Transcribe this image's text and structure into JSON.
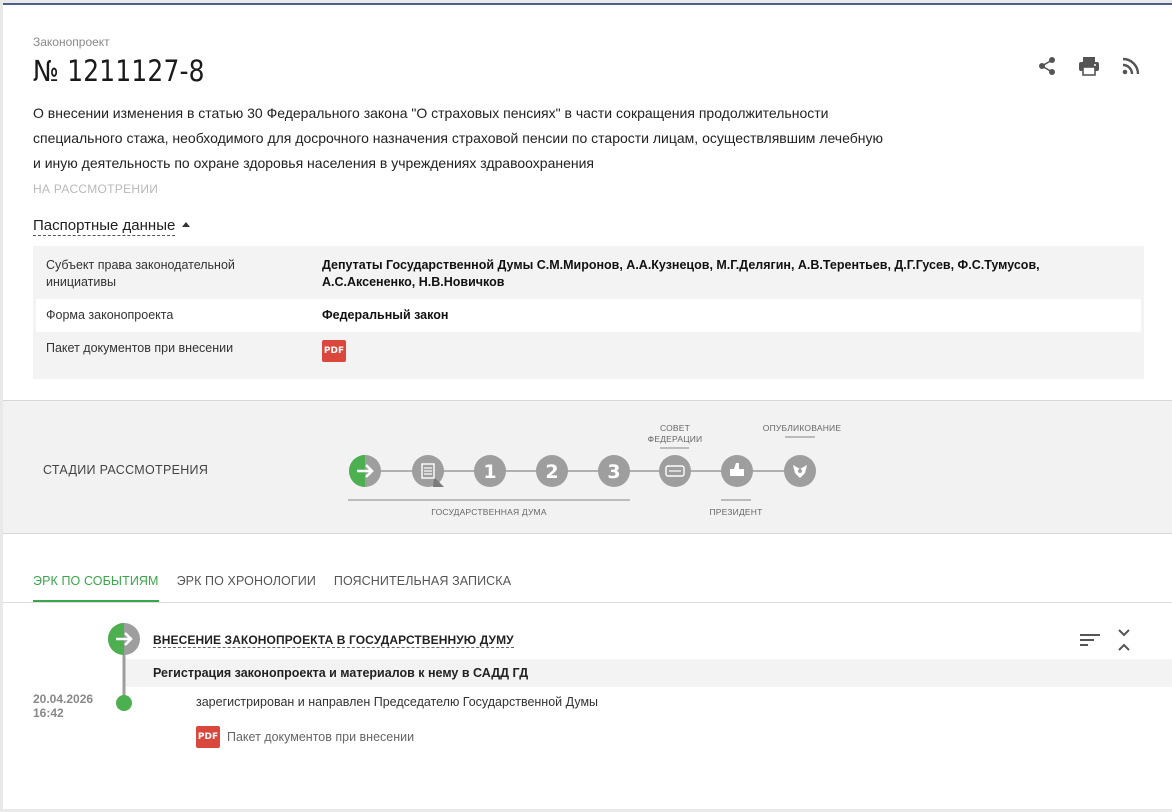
{
  "header": {
    "kicker": "Законопроект",
    "number": "№ 1211127-8",
    "description": "О внесении изменения в статью 30 Федерального закона \"О страховых пенсиях\" в части сокращения продолжительности специального стажа, необходимого для досрочного назначения страховой пенсии по старости лицам, осуществлявшим лечебную и иную деятельность по охране здоровья населения в учреждениях здравоохранения",
    "status": "НА РАССМОТРЕНИИ",
    "passport_toggle": "Паспортные данные"
  },
  "toolbar": {
    "icons": [
      "share-icon",
      "print-icon",
      "rss-icon"
    ]
  },
  "passport": {
    "rows": [
      {
        "key": "Субъект права законодательной инициативы",
        "value": "Депутаты Государственной Думы С.М.Миронов, А.А.Кузнецов, М.Г.Делягин, А.В.Терентьев, Д.Г.Гусев, Ф.С.Тумусов, А.С.Аксененко, Н.В.Новичков"
      },
      {
        "key": "Форма законопроекта",
        "value": "Федеральный закон"
      },
      {
        "key": "Пакет документов при внесении",
        "value": "PDF"
      }
    ]
  },
  "stages": {
    "title": "СТАДИИ РАССМОТРЕНИЯ",
    "items": [
      {
        "icon": "arrow-right-icon",
        "label": "",
        "active": true
      },
      {
        "icon": "document-icon",
        "label": "",
        "active": false
      },
      {
        "icon": "reading-1-icon",
        "label": "1",
        "active": false
      },
      {
        "icon": "reading-2-icon",
        "label": "2",
        "active": false
      },
      {
        "icon": "reading-3-icon",
        "label": "3",
        "active": false
      },
      {
        "icon": "federation-council-icon",
        "label": "",
        "active": false
      },
      {
        "icon": "president-icon",
        "label": "",
        "active": false
      },
      {
        "icon": "publication-emblem-icon",
        "label": "",
        "active": false
      }
    ],
    "captions": {
      "duma": "ГОСУДАРСТВЕННАЯ ДУМА",
      "council_line1": "СОВЕТ",
      "council_line2": "ФЕДЕРАЦИИ",
      "president": "ПРЕЗИДЕНТ",
      "publication": "ОПУБЛИКОВАНИЕ"
    },
    "colors": {
      "active": "#4caf50",
      "inactive": "#9e9e9e"
    }
  },
  "tabs": [
    {
      "label": "ЭРК ПО СОБЫТИЯМ",
      "active": true
    },
    {
      "label": "ЭРК ПО ХРОНОЛОГИИ",
      "active": false
    },
    {
      "label": "ПОЯСНИТЕЛЬНАЯ ЗАПИСКА",
      "active": false
    }
  ],
  "events": {
    "title": "ВНЕСЕНИЕ ЗАКОНОПРОЕКТА В ГОСУДАРСТВЕННУЮ ДУМУ",
    "subtitle": "Регистрация законопроекта и материалов к нему в САДД ГД",
    "date": "20.04.2026",
    "time": "16:42",
    "text": "зарегистрирован и направлен Председателю Государственной Думы",
    "doc_badge": "PDF",
    "doc_label": "Пакет документов при внесении"
  },
  "accent": "#3aa64a"
}
